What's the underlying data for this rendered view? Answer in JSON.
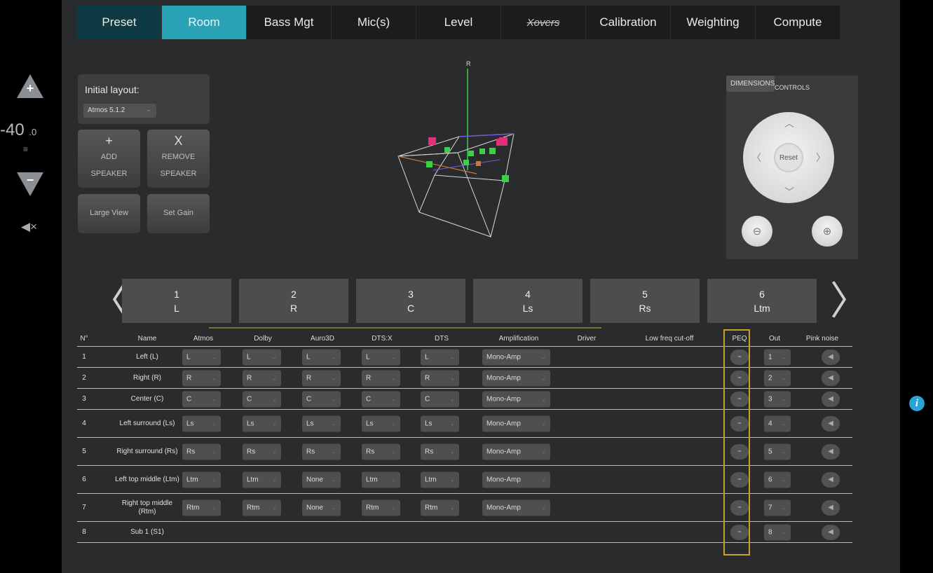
{
  "volume": {
    "value": "-40",
    "decimal": ".0",
    "unit": "≡"
  },
  "tabs": [
    "Preset",
    "Room",
    "Bass Mgt",
    "Mic(s)",
    "Level",
    "Xovers",
    "Calibration",
    "Weighting",
    "Compute"
  ],
  "active_tab": "Room",
  "layout": {
    "label": "Initial layout:",
    "value": "Atmos 5.1.2"
  },
  "buttons": {
    "add": {
      "symbol": "+",
      "line1": "ADD",
      "line2": "SPEAKER"
    },
    "remove": {
      "symbol": "X",
      "line1": "REMOVE",
      "line2": "SPEAKER"
    },
    "large_view": "Large View",
    "set_gain": "Set Gain"
  },
  "viewer": {
    "axis_label": "R"
  },
  "camera": {
    "tab_controls": "CONTROLS",
    "tab_dimensions": "DIMENSIONS",
    "reset": "Reset"
  },
  "speakers_carousel": [
    {
      "num": "1",
      "name": "L"
    },
    {
      "num": "2",
      "name": "R"
    },
    {
      "num": "3",
      "name": "C"
    },
    {
      "num": "4",
      "name": "Ls"
    },
    {
      "num": "5",
      "name": "Rs"
    },
    {
      "num": "6",
      "name": "Ltm"
    }
  ],
  "table": {
    "headers": [
      "N°",
      "Name",
      "Atmos",
      "Dolby",
      "Auro3D",
      "DTS:X",
      "DTS",
      "Amplification",
      "Driver",
      "Low freq cut-off",
      "PEQ",
      "Out",
      "Pink noise"
    ],
    "rows": [
      {
        "n": "1",
        "name": "Left (L)",
        "atmos": "L",
        "dolby": "L",
        "auro": "L",
        "dtsx": "L",
        "dts": "L",
        "amp": "Mono-Amp",
        "out": "1"
      },
      {
        "n": "2",
        "name": "Right (R)",
        "atmos": "R",
        "dolby": "R",
        "auro": "R",
        "dtsx": "R",
        "dts": "R",
        "amp": "Mono-Amp",
        "out": "2"
      },
      {
        "n": "3",
        "name": "Center (C)",
        "atmos": "C",
        "dolby": "C",
        "auro": "C",
        "dtsx": "C",
        "dts": "C",
        "amp": "Mono-Amp",
        "out": "3"
      },
      {
        "n": "4",
        "name": "Left surround (Ls)",
        "atmos": "Ls",
        "dolby": "Ls",
        "auro": "Ls",
        "dtsx": "Ls",
        "dts": "Ls",
        "amp": "Mono-Amp",
        "out": "4"
      },
      {
        "n": "5",
        "name": "Right surround (Rs)",
        "atmos": "Rs",
        "dolby": "Rs",
        "auro": "Rs",
        "dtsx": "Rs",
        "dts": "Rs",
        "amp": "Mono-Amp",
        "out": "5"
      },
      {
        "n": "6",
        "name": "Left top middle (Ltm)",
        "atmos": "Ltm",
        "dolby": "Ltm",
        "auro": "None",
        "dtsx": "Ltm",
        "dts": "Ltm",
        "amp": "Mono-Amp",
        "out": "6"
      },
      {
        "n": "7",
        "name": "Right top middle (Rtm)",
        "atmos": "Rtm",
        "dolby": "Rtm",
        "auro": "None",
        "dtsx": "Rtm",
        "dts": "Rtm",
        "amp": "Mono-Amp",
        "out": "7"
      },
      {
        "n": "8",
        "name": "Sub 1 (S1)",
        "out": "8"
      }
    ]
  },
  "colors": {
    "accent": "#2aa3b7",
    "highlight": "#c7a12a",
    "info": "#2aa3d8"
  }
}
